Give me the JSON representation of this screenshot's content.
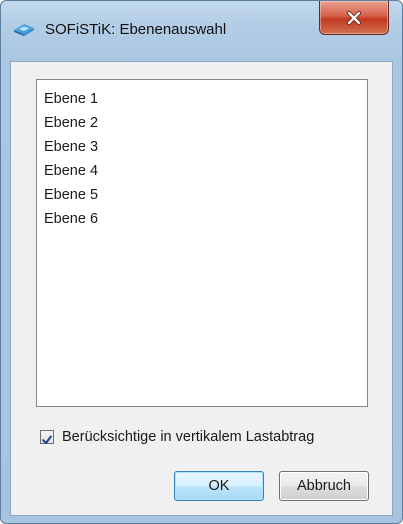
{
  "window": {
    "title": "SOFiSTiK: Ebenenauswahl",
    "app_icon": "sofistik-logo-icon",
    "close_icon": "close-icon"
  },
  "list": {
    "items": [
      {
        "label": "Ebene 1"
      },
      {
        "label": "Ebene 2"
      },
      {
        "label": "Ebene 3"
      },
      {
        "label": "Ebene 4"
      },
      {
        "label": "Ebene 5"
      },
      {
        "label": "Ebene 6"
      }
    ]
  },
  "options": {
    "vertical_load": {
      "label": "Berücksichtige in vertikalem Lastabtrag",
      "checked": true
    }
  },
  "buttons": {
    "ok_label": "OK",
    "cancel_label": "Abbruch"
  },
  "colors": {
    "title_bar": "#b3cde6",
    "close_button": "#c9452d",
    "dialog_body": "#f0f0f0",
    "ok_button_accent": "#3c7fb1"
  }
}
